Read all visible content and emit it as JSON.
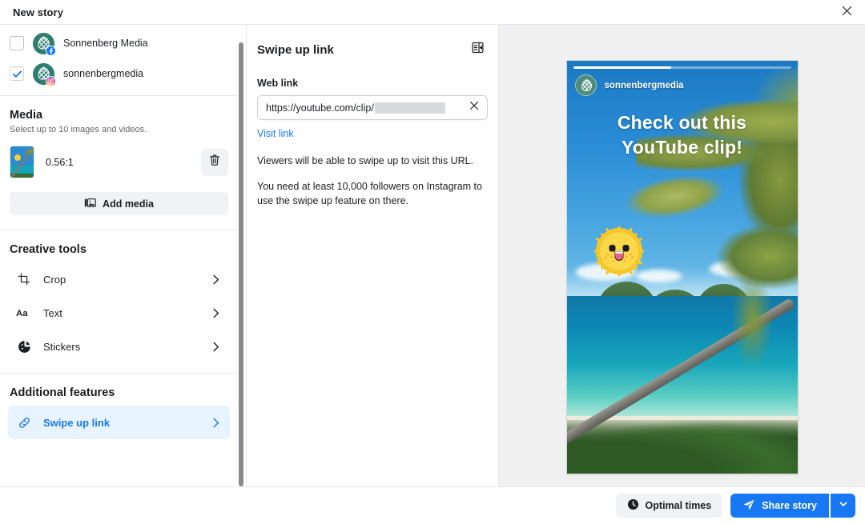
{
  "window": {
    "title": "New story",
    "close_icon": "close-icon"
  },
  "accounts": {
    "items": [
      {
        "name": "Sonnenberg Media",
        "platform": "facebook",
        "checked": false
      },
      {
        "name": "sonnenbergmedia",
        "platform": "instagram",
        "checked": true
      }
    ]
  },
  "media": {
    "title": "Media",
    "subtitle": "Select up to 10 images and videos.",
    "items": [
      {
        "ratio": "0.56:1",
        "delete_icon": "trash-icon"
      }
    ],
    "add_media_label": "Add media",
    "add_media_icon": "image-icon"
  },
  "creative_tools": {
    "title": "Creative tools",
    "items": [
      {
        "label": "Crop",
        "icon": "crop-icon"
      },
      {
        "label": "Text",
        "icon": "text-icon"
      },
      {
        "label": "Stickers",
        "icon": "sticker-icon"
      }
    ]
  },
  "additional_features": {
    "title": "Additional features",
    "items": [
      {
        "label": "Swipe up link",
        "icon": "link-icon",
        "active": true
      }
    ]
  },
  "detail_panel": {
    "title": "Swipe up link",
    "panel_toggle_icon": "panel-layout-icon",
    "web_link_label": "Web link",
    "web_link_value": "https://youtube.com/clip/",
    "web_link_redacted": true,
    "clear_icon": "close-icon",
    "visit_link_label": "Visit link",
    "helper_text_1": "Viewers will be able to swipe up to visit this URL.",
    "helper_text_2": "You need at least 10,000 followers on Instagram to use the swipe up feature on there."
  },
  "preview": {
    "username": "sonnenbergmedia",
    "caption_line_1": "Check out this",
    "caption_line_2": "YouTube clip!",
    "progress_percent": 45,
    "sticker": "sun-sticker"
  },
  "footer": {
    "optimal_times_label": "Optimal times",
    "optimal_times_icon": "clock-icon",
    "share_label": "Share story",
    "share_icon": "send-icon",
    "share_caret_icon": "chevron-down-icon"
  },
  "colors": {
    "accent_blue": "#1877f2",
    "active_bg": "#e7f3ff",
    "surface_gray": "#f0f2f5",
    "preview_bg": "#f0f0f0",
    "avatar_teal": "#2e7d6f"
  }
}
